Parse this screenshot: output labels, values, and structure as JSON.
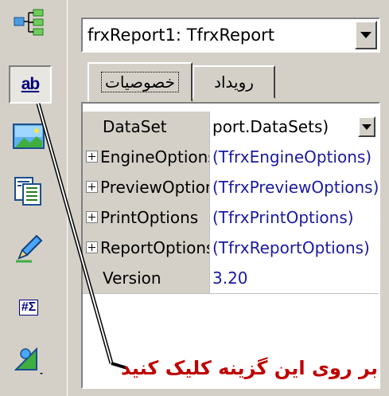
{
  "toolbar": {
    "tools": [
      {
        "icon": "band-tree-icon"
      },
      {
        "icon": "text-object-icon",
        "label": "ab",
        "pressed": true
      },
      {
        "icon": "picture-icon"
      },
      {
        "icon": "subreport-icon"
      },
      {
        "icon": "pencil-draw-icon"
      },
      {
        "icon": "system-text-icon",
        "label": "#Σ"
      },
      {
        "icon": "shape-icon"
      }
    ]
  },
  "inspector": {
    "object_selector": "frxReport1: TfrxReport",
    "tabs": [
      {
        "label": "خصوصیات",
        "active": true
      },
      {
        "label": "رویداد",
        "active": false
      }
    ],
    "properties": [
      {
        "name": "DataSet",
        "value": "port.DataSets)",
        "expandable": false,
        "has_dropdown": true,
        "value_color": "black"
      },
      {
        "name": "EngineOptions",
        "value": "(TfrxEngineOptions)",
        "expandable": true
      },
      {
        "name": "PreviewOptions",
        "value": "(TfrxPreviewOptions)",
        "expandable": true
      },
      {
        "name": "PrintOptions",
        "value": "(TfrxPrintOptions)",
        "expandable": true
      },
      {
        "name": "ReportOptions",
        "value": "(TfrxReportOptions)",
        "expandable": true
      },
      {
        "name": "Version",
        "value": "3.20",
        "expandable": false
      }
    ]
  },
  "annotation": {
    "text": "بر روی این گزینه کلیک کنید",
    "color": "#c00000"
  }
}
